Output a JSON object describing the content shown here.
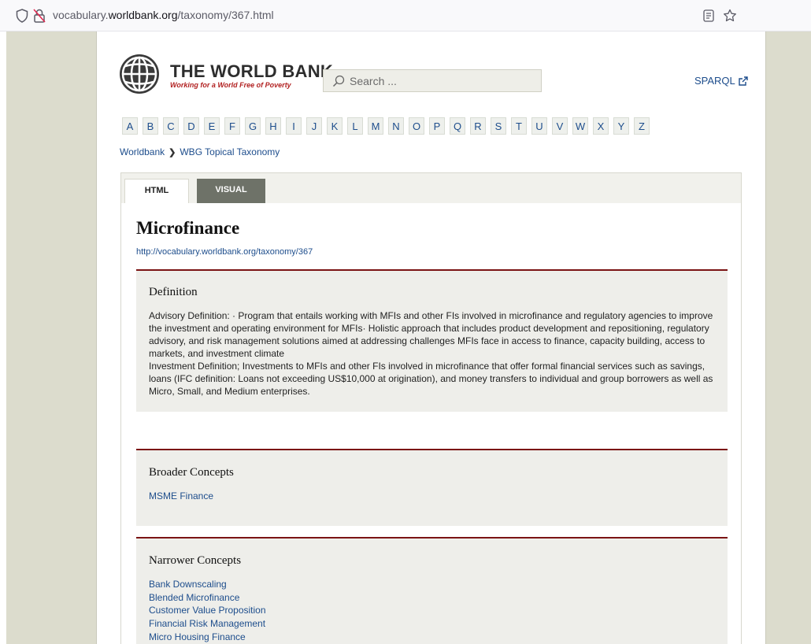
{
  "browser": {
    "url_prefix": "vocabulary.",
    "url_domain": "worldbank.org",
    "url_path": "/taxonomy/367.html"
  },
  "header": {
    "logo_title": "THE WORLD BANK",
    "logo_subtitle": "Working for a World Free of Poverty",
    "search_placeholder": "Search ...",
    "sparql_label": "SPARQL"
  },
  "alphabet": [
    "A",
    "B",
    "C",
    "D",
    "E",
    "F",
    "G",
    "H",
    "I",
    "J",
    "K",
    "L",
    "M",
    "N",
    "O",
    "P",
    "Q",
    "R",
    "S",
    "T",
    "U",
    "V",
    "W",
    "X",
    "Y",
    "Z"
  ],
  "breadcrumb": {
    "root": "Worldbank",
    "current": "WBG Topical Taxonomy"
  },
  "tabs": {
    "html": "HTML",
    "visual": "VISUAL"
  },
  "concept": {
    "title": "Microfinance",
    "uri": "http://vocabulary.worldbank.org/taxonomy/367"
  },
  "definition": {
    "heading": "Definition",
    "advisory": "Advisory Definition: ·        Program that entails working with MFIs and other FIs involved in microfinance and regulatory agencies to improve the investment and operating environment for MFIs·        Holistic approach that includes product development and repositioning, regulatory advisory, and risk management solutions aimed at addressing challenges MFIs face in access to finance, capacity building, access to markets, and investment climate",
    "investment": "Investment Definition; Investments to MFIs and other FIs involved in microfinance that offer formal financial services such as savings, loans (IFC definition: Loans not exceeding US$10,000 at origination), and money transfers to individual and group borrowers as well as Micro, Small, and Medium enterprises."
  },
  "broader": {
    "heading": "Broader Concepts",
    "items": [
      "MSME Finance"
    ]
  },
  "narrower": {
    "heading": "Narrower Concepts",
    "items": [
      "Bank Downscaling",
      "Blended Microfinance",
      "Customer Value Proposition",
      "Financial Risk Management",
      "Micro Housing Finance"
    ]
  }
}
